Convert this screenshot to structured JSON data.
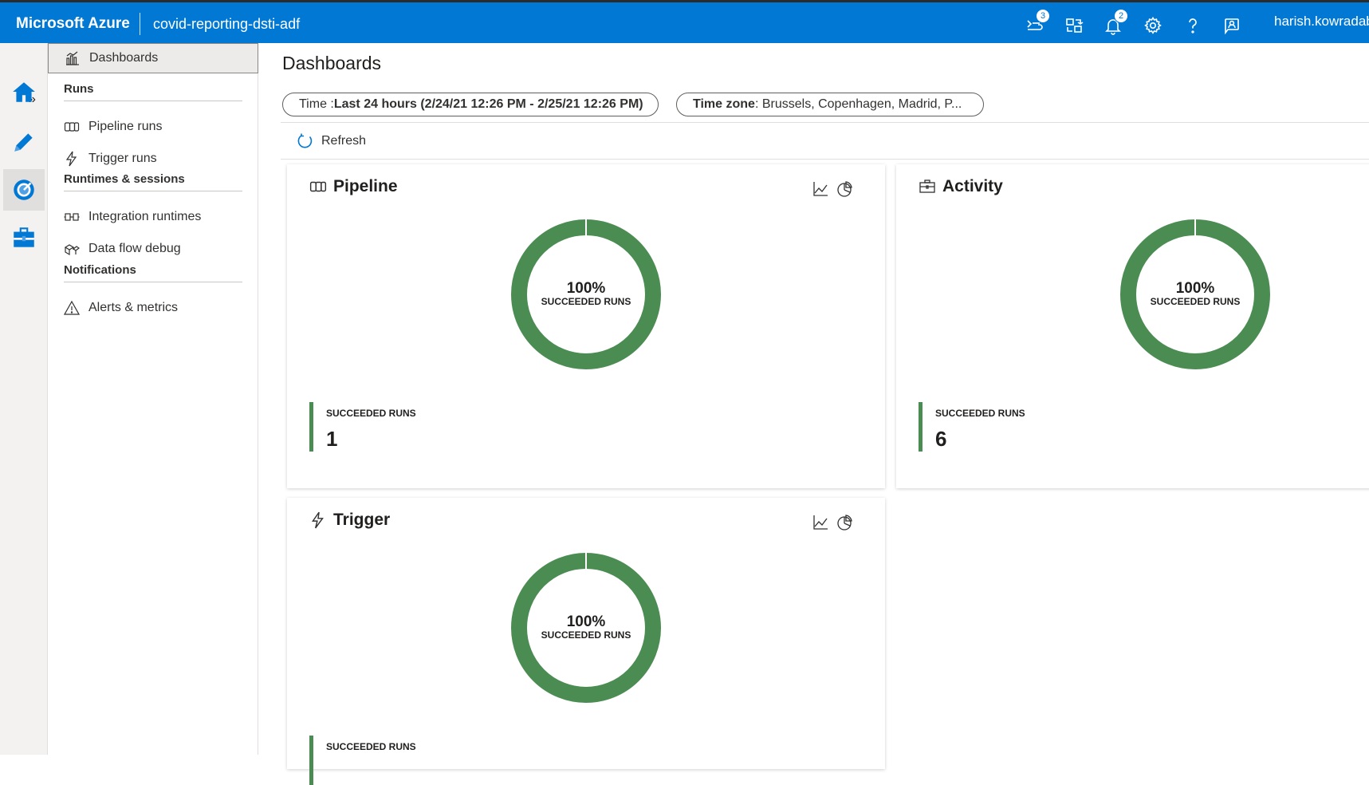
{
  "topbar": {
    "brand": "Microsoft Azure",
    "factory_name": "covid-reporting-dsti-adf",
    "icons": [
      {
        "name": "cloudshell-icon",
        "badge": "3"
      },
      {
        "name": "directory-switch-icon",
        "badge": ""
      },
      {
        "name": "notifications-icon",
        "badge": "2"
      },
      {
        "name": "settings-icon",
        "badge": ""
      },
      {
        "name": "help-icon",
        "badge": ""
      },
      {
        "name": "feedback-icon",
        "badge": ""
      }
    ],
    "user": "harish.kowradab"
  },
  "rail": {
    "expand_glyph": "»",
    "items": [
      "home-icon",
      "author-icon",
      "monitor-icon",
      "manage-icon"
    ],
    "active": "monitor-icon",
    "accent": "#0078d4"
  },
  "subnav": {
    "selected": "Dashboards",
    "dashboards": "Dashboards",
    "runs_header": "Runs",
    "pipeline_runs": "Pipeline runs",
    "trigger_runs": "Trigger runs",
    "runtimes_header": "Runtimes & sessions",
    "integration_runtimes": "Integration runtimes",
    "data_flow_debug": "Data flow debug",
    "notifications_header": "Notifications",
    "alerts_metrics": "Alerts & metrics"
  },
  "main": {
    "title": "Dashboards",
    "time_filter": {
      "label": "Time : ",
      "value": "Last 24 hours (2/24/21 12:26 PM - 2/25/21 12:26 PM)"
    },
    "timezone_filter": {
      "label": "Time zone",
      "value": " : Brussels, Copenhagen, Madrid, P..."
    },
    "refresh_label": "Refresh"
  },
  "cards": {
    "pipeline": {
      "title": "Pipeline",
      "percent_text": "100%",
      "center_label": "SUCCEEDED RUNS",
      "stat_label": "SUCCEEDED RUNS",
      "stat_value": "1",
      "succeeded_fraction": 1.0
    },
    "activity": {
      "title": "Activity",
      "percent_text": "100%",
      "center_label": "SUCCEEDED RUNS",
      "stat_label": "SUCCEEDED RUNS",
      "stat_value": "6",
      "succeeded_fraction": 1.0
    },
    "trigger": {
      "title": "Trigger",
      "percent_text": "100%",
      "center_label": "SUCCEEDED RUNS",
      "stat_label": "SUCCEEDED RUNS",
      "succeeded_fraction": 1.0
    }
  },
  "colors": {
    "success": "#4a8c52",
    "azure_blue": "#0078d4"
  }
}
